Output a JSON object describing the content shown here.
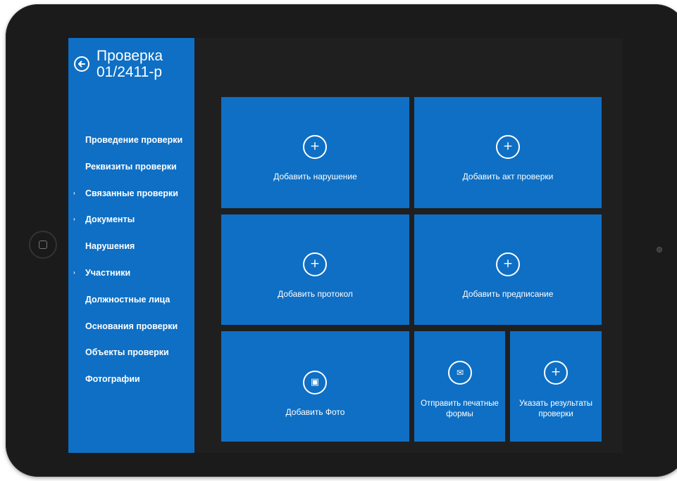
{
  "header": {
    "title_line1": "Проверка",
    "title_line2": "01/2411-р"
  },
  "sidebar": {
    "items": [
      {
        "label": "Проведение проверки",
        "expandable": false
      },
      {
        "label": "Реквизиты проверки",
        "expandable": false
      },
      {
        "label": "Связанные проверки",
        "expandable": true
      },
      {
        "label": "Документы",
        "expandable": true
      },
      {
        "label": "Нарушения",
        "expandable": false
      },
      {
        "label": "Участники",
        "expandable": true
      },
      {
        "label": "Должностные лица",
        "expandable": false
      },
      {
        "label": "Основания проверки",
        "expandable": false
      },
      {
        "label": "Объекты проверки",
        "expandable": false
      },
      {
        "label": "Фотографии",
        "expandable": false
      }
    ],
    "caret_glyph": "›"
  },
  "tiles": {
    "add_violation": {
      "label": "Добавить нарушение",
      "icon": "plus-circle-icon"
    },
    "add_act": {
      "label": "Добавить акт проверки",
      "icon": "plus-circle-icon"
    },
    "add_protocol": {
      "label": "Добавить протокол",
      "icon": "plus-circle-icon"
    },
    "add_prescription": {
      "label": "Добавить предписание",
      "icon": "plus-circle-icon"
    },
    "add_photo": {
      "label": "Добавить Фото",
      "icon": "camera-icon"
    },
    "send_forms": {
      "label_line1": "Отправить печатные",
      "label_line2": "формы",
      "icon": "mail-icon"
    },
    "set_results": {
      "label_line1": "Указать результаты",
      "label_line2": "проверки",
      "icon": "plus-circle-icon"
    }
  },
  "icons": {
    "plus": "+",
    "mail": "✉",
    "camera": "▣"
  },
  "colors": {
    "accent": "#0e6fc4",
    "background": "#1f1f1f",
    "device": "#1b1b1b"
  }
}
